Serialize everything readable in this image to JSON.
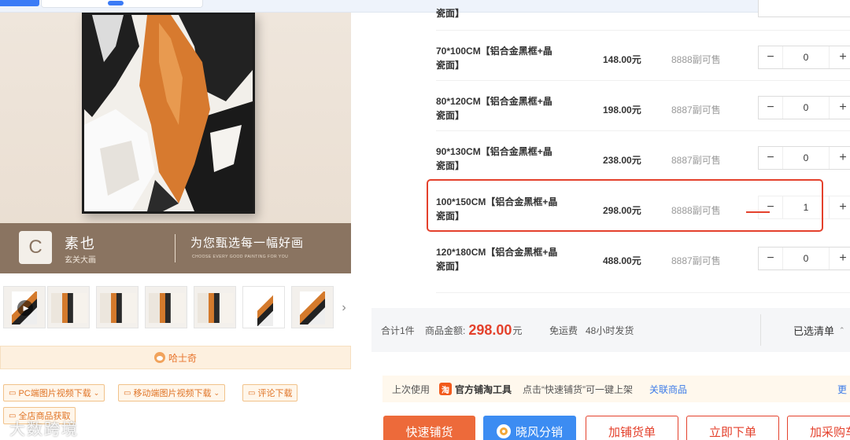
{
  "colors": {
    "accent": "#e4412c",
    "orange_button": "#ed6a3a",
    "blue_button": "#3c8cf2",
    "brand_bar": "#8a7461",
    "husky_bar_bg": "#fdf0df"
  },
  "product_image": {
    "brand_logo_letter": "C",
    "brand_name": "素也",
    "brand_sub": "玄关大画",
    "slogan": "为您甄选每一幅好画",
    "slogan_en": "CHOOSE EVERY GOOD PAINTING FOR YOU"
  },
  "thumbnails": {
    "play_icon": "play-icon",
    "next_icon": "chevron-right-icon",
    "next_glyph": "›"
  },
  "husky": {
    "label": "哈士奇",
    "icon": "husky-icon"
  },
  "downloads": {
    "pc": "PC端图片视频下载",
    "mobile": "移动端图片视频下载",
    "reviews": "评论下载",
    "all_shop": "全店商品获取"
  },
  "watermark": "大数跨境",
  "sku": {
    "partial_top_name": "瓷面】",
    "rows": [
      {
        "name_line1": "70*100CM【铝合金黑框+晶",
        "name_line2": "瓷面】",
        "price": "148.00元",
        "stock": "8888副可售",
        "qty": "0"
      },
      {
        "name_line1": "80*120CM【铝合金黑框+晶",
        "name_line2": "瓷面】",
        "price": "198.00元",
        "stock": "8887副可售",
        "qty": "0"
      },
      {
        "name_line1": "90*130CM【铝合金黑框+晶",
        "name_line2": "瓷面】",
        "price": "238.00元",
        "stock": "8887副可售",
        "qty": "0"
      },
      {
        "name_line1": "100*150CM【铝合金黑框+晶",
        "name_line2": "瓷面】",
        "price": "298.00元",
        "stock": "8888副可售",
        "qty": "1"
      },
      {
        "name_line1": "120*180CM【铝合金黑框+晶",
        "name_line2": "瓷面】",
        "price": "488.00元",
        "stock": "8887副可售",
        "qty": "0"
      }
    ],
    "minus": "−",
    "plus": "+"
  },
  "summary": {
    "total_count": "合计1件",
    "amount_label": "商品金额:",
    "amount": "298.00",
    "amount_unit": "元",
    "shipping": "免运费",
    "dispatch": "48小时发货",
    "selected_list": "已选清单",
    "caret": "⌃"
  },
  "toolbar": {
    "last_used": "上次使用",
    "tool_icon_text": "淘",
    "tool_name": "官方铺淘工具",
    "hint": "点击“快速铺货”可一键上架",
    "link": "关联商品",
    "more": "更"
  },
  "actions": {
    "quick_list": "快速铺货",
    "xiaofeng": "晓风分销",
    "add_list": "加铺货单",
    "buy_now": "立即下单",
    "add_cart": "加采购车"
  }
}
